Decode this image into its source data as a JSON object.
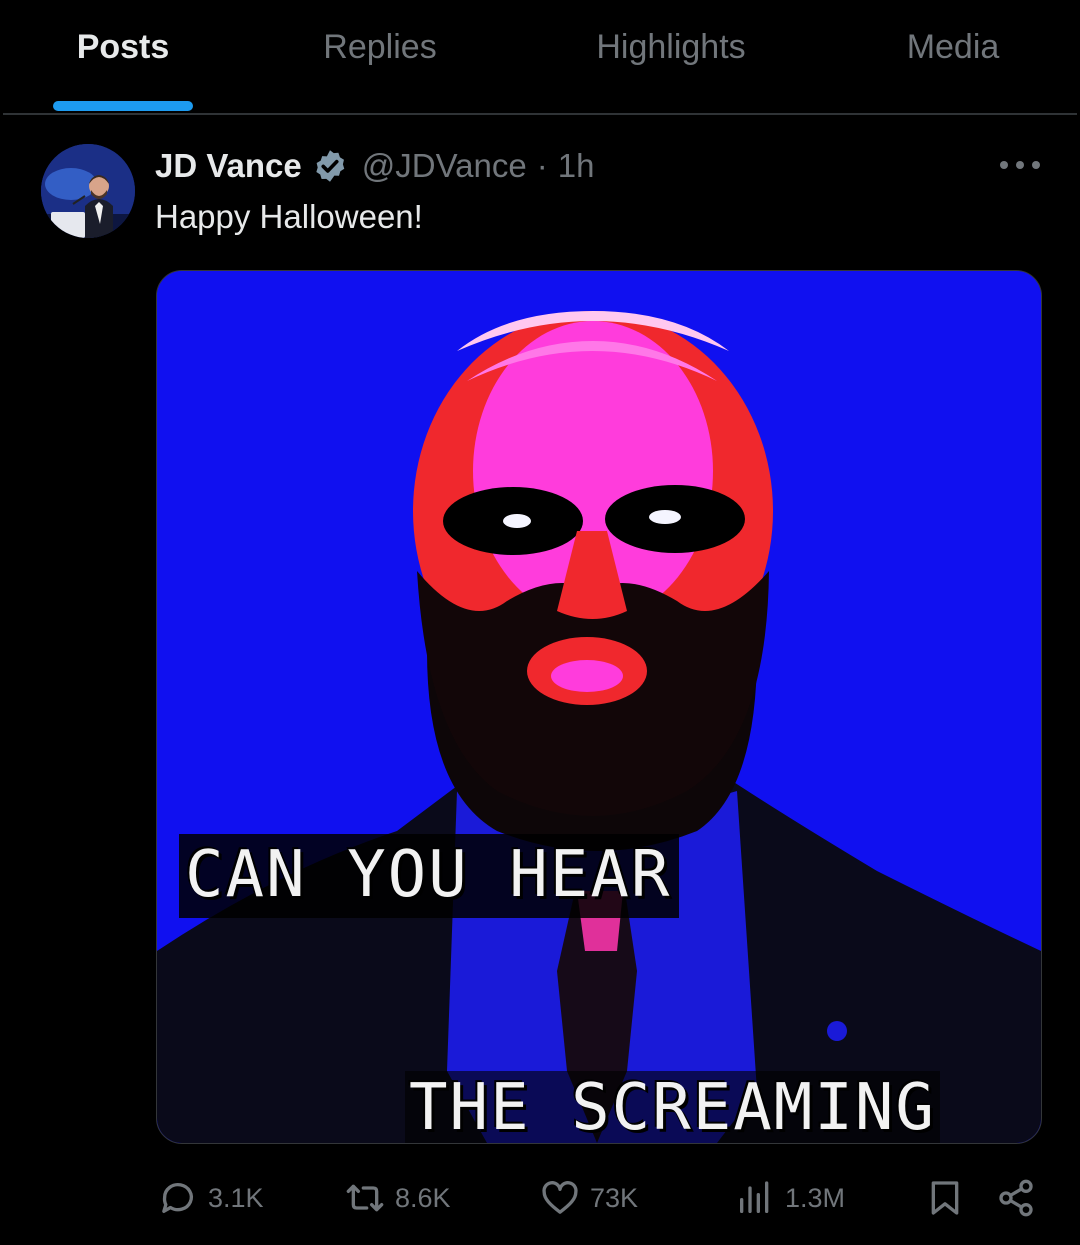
{
  "tabs": [
    {
      "label": "Posts",
      "active": true
    },
    {
      "label": "Replies",
      "active": false
    },
    {
      "label": "Highlights",
      "active": false
    },
    {
      "label": "Media",
      "active": false
    }
  ],
  "post": {
    "author": {
      "display_name": "JD Vance",
      "verified": true,
      "handle": "@JDVance"
    },
    "separator": "·",
    "time": "1h",
    "text": "Happy Halloween!",
    "media": {
      "caption_line1": "CAN YOU HEAR",
      "caption_line2": "THE SCREAMING"
    },
    "stats": {
      "replies": "3.1K",
      "reposts": "8.6K",
      "likes": "73K",
      "views": "1.3M"
    }
  },
  "icons": {
    "more": "more-horizontal-icon",
    "reply": "reply-icon",
    "repost": "repost-icon",
    "like": "heart-icon",
    "views": "views-icon",
    "bookmark": "bookmark-icon",
    "share": "share-icon"
  },
  "colors": {
    "background": "#000000",
    "accent": "#1d9bf0",
    "muted_text": "#71767b",
    "primary_text": "#e7e9ea",
    "media_blue": "#1010f0",
    "media_pink": "#ff3cdc",
    "media_red": "#f0282d"
  }
}
